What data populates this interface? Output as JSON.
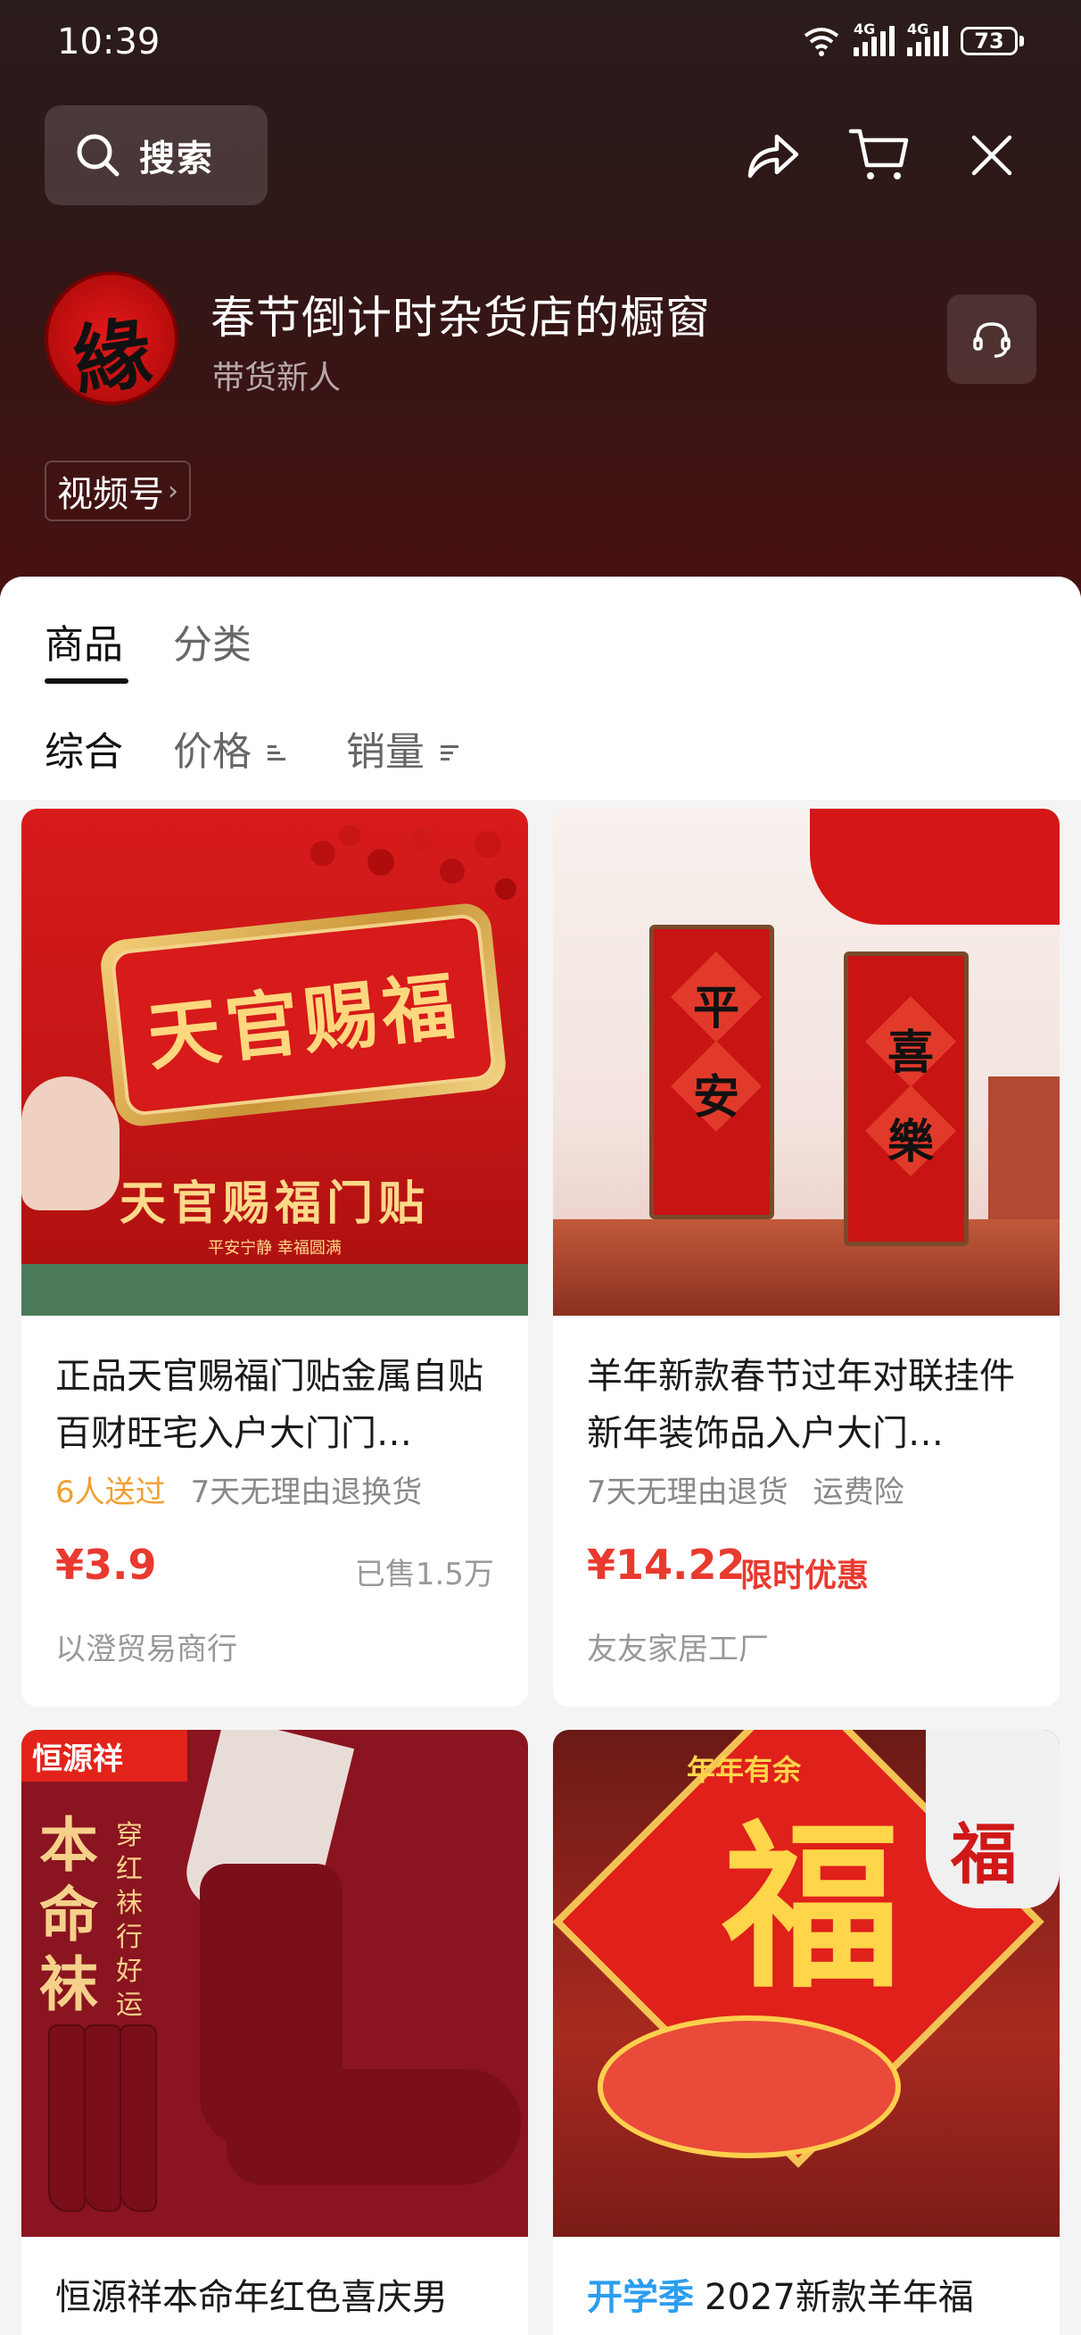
{
  "status_bar": {
    "time": "10:39",
    "wifi_label": "6",
    "sim1_label": "4G",
    "sim2_label": "4G",
    "battery": "73"
  },
  "top_nav": {
    "search_label": "搜索",
    "icons": [
      "share-icon",
      "cart-icon",
      "close-icon"
    ]
  },
  "shop": {
    "avatar_glyph": "緣",
    "name": "春节倒计时杂货店的橱窗",
    "subtitle": "带货新人",
    "channel_button": "视频号",
    "channel_chevron": "›"
  },
  "tabs": [
    {
      "label": "商品",
      "active": true
    },
    {
      "label": "分类",
      "active": false
    }
  ],
  "sort": [
    {
      "label": "综合",
      "active": true
    },
    {
      "label": "价格",
      "active": false
    },
    {
      "label": "销量",
      "active": false
    }
  ],
  "products": [
    {
      "image_text": {
        "plaque": "天官赐福",
        "caption": "天官赐福门贴",
        "sub": "平安宁静 幸福圆满"
      },
      "title": "正品天官赐福门贴金属自贴百财旺宅入户大门门…",
      "tags": [
        "6人送过",
        "7天无理由退换货"
      ],
      "price": "¥3.9",
      "sold": "已售1.5万",
      "store": "以澄贸易商行"
    },
    {
      "image_text": {
        "left": [
          "平",
          "安"
        ],
        "right": [
          "喜",
          "樂"
        ]
      },
      "title": "羊年新款春节过年对联挂件新年装饰品入户大门…",
      "tags": [
        "7天无理由退货",
        "运费险"
      ],
      "price": "¥14.22",
      "price_note": "限时优惠",
      "store": "友友家居工厂"
    },
    {
      "image_text": {
        "logo": "恒源祥",
        "title": "本命袜",
        "slogan": "穿红袜行好运"
      },
      "title_prefix": "",
      "title": "恒源祥本命年红色喜庆男"
    },
    {
      "image_text": {
        "fu": "福",
        "label": "年年有余",
        "lion": "福"
      },
      "title_prefix": "开学季",
      "title": "2027新款羊年福"
    }
  ],
  "colors": {
    "accent_red": "#e83a2f",
    "tag_orange": "#f0a030",
    "promo_blue": "#2a9ef0"
  }
}
